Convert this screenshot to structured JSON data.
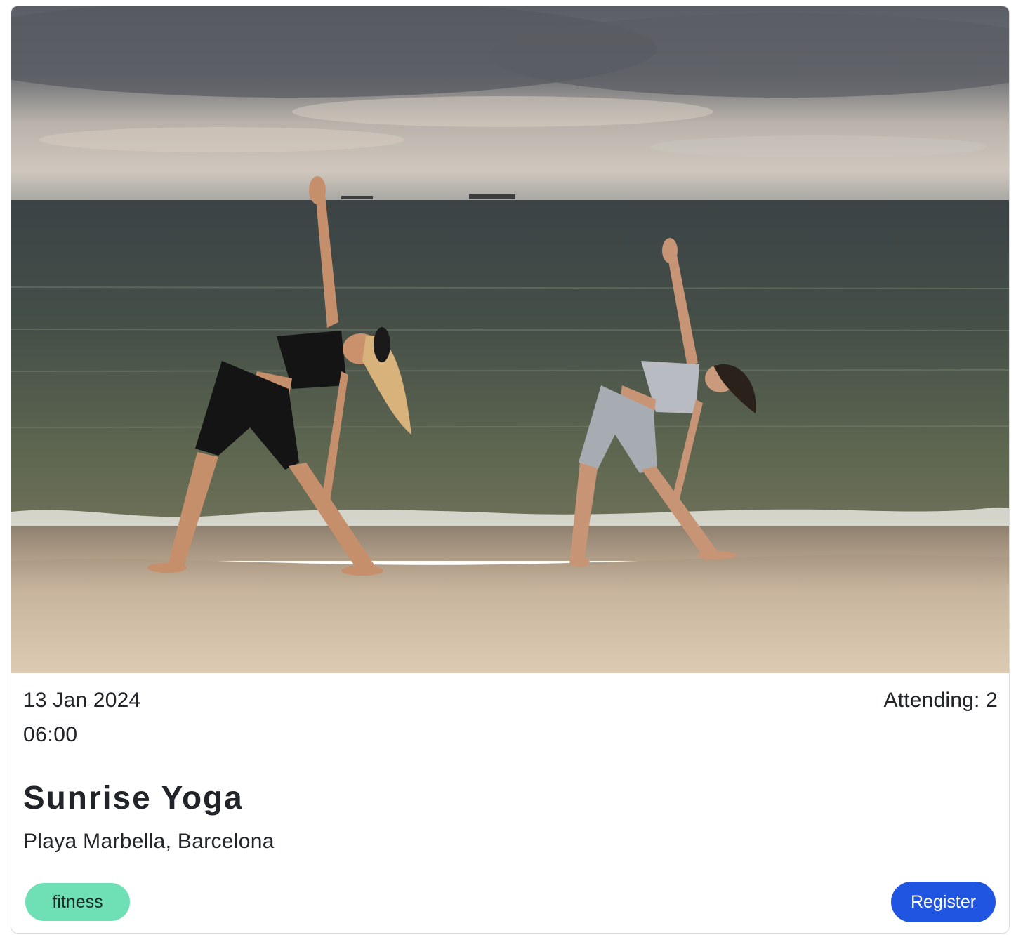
{
  "event": {
    "date": "13 Jan 2024",
    "time": "06:00",
    "attending": "Attending: 2",
    "title": "Sunrise Yoga",
    "location": "Playa Marbella, Barcelona",
    "tag": "fitness",
    "register_label": "Register"
  },
  "image": {
    "subject": "two women doing triangle yoga pose on a beach by the sea under cloudy sky"
  },
  "colors": {
    "tag_bg": "#6fe0b6",
    "register_bg": "#1f55e0",
    "text": "#212529"
  }
}
